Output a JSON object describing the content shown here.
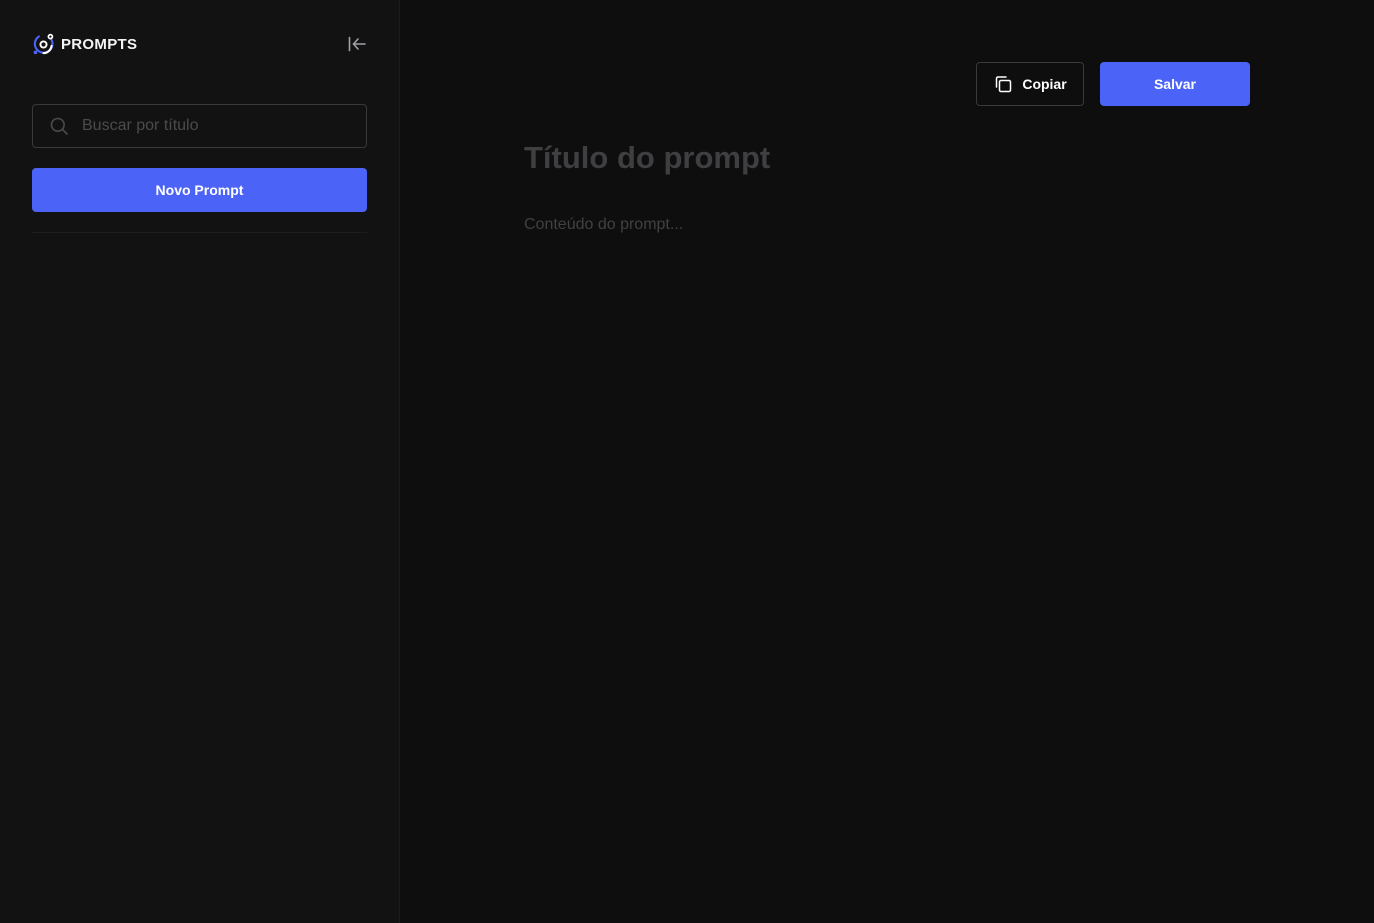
{
  "sidebar": {
    "brand": {
      "name": "PROMPTS",
      "logo_icon": "orbit-logo-icon",
      "accent": "#4b63f7"
    },
    "collapse_icon": "collapse-left-icon",
    "search": {
      "placeholder": "Buscar por título",
      "value": "",
      "icon": "search-icon"
    },
    "new_prompt_label": "Novo Prompt"
  },
  "editor": {
    "copy_label": "Copiar",
    "copy_icon": "copy-icon",
    "save_label": "Salvar",
    "title_placeholder": "Título do prompt",
    "title_value": "",
    "content_placeholder": "Conteúdo do prompt...",
    "content_value": ""
  },
  "colors": {
    "primary": "#4b63f7",
    "sidebar_bg": "#121212",
    "main_bg": "#0e0e0e"
  }
}
